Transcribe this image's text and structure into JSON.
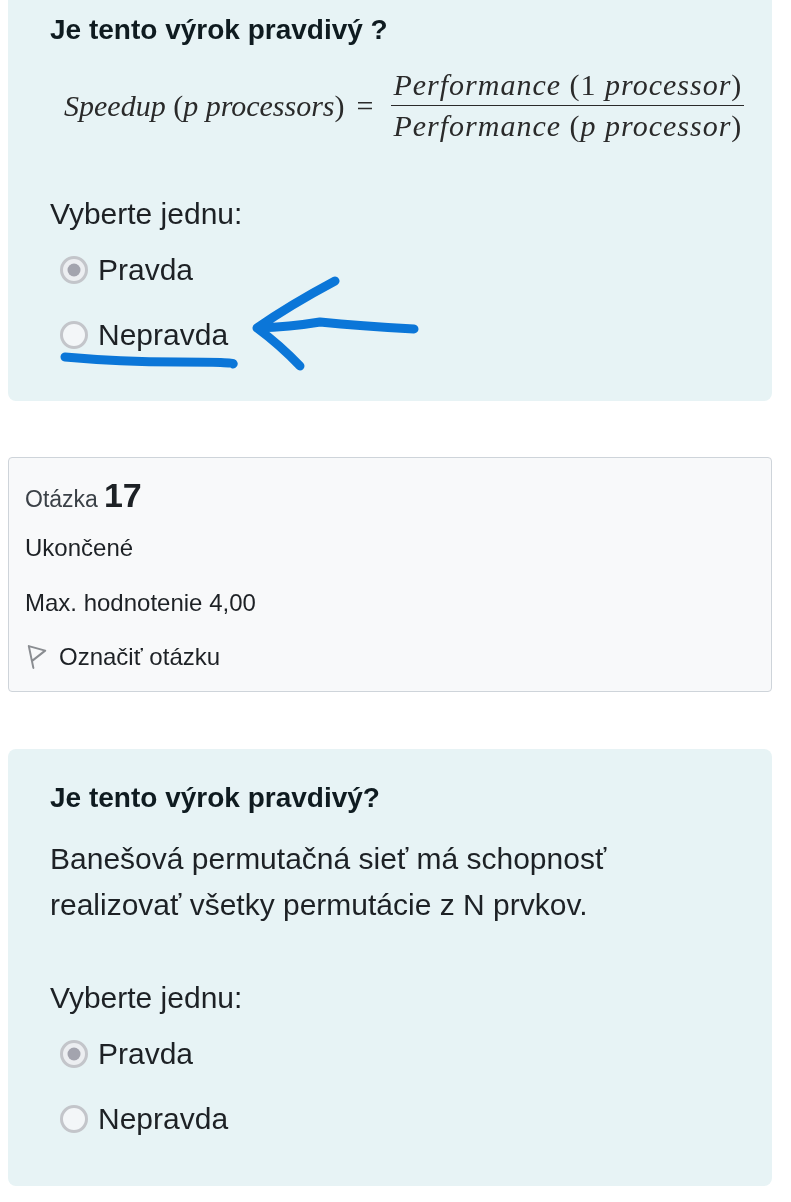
{
  "question_1": {
    "title": "Je tento výrok pravdivý ?",
    "formula": {
      "lhs": "*Speedup* (*p processors*)",
      "operator": "=",
      "numerator": "*Performance* (1 *processor*)",
      "denominator": "*Performance* (*p processor*)"
    },
    "prompt": "Vyberte jednu:",
    "options": [
      {
        "label": "Pravda",
        "selected": true,
        "marked": false
      },
      {
        "label": "Nepravda",
        "selected": false,
        "marked": true
      }
    ]
  },
  "question_info": {
    "label": "Otázka",
    "number": "17",
    "status": "Ukončené",
    "max_grade": "Max. hodnotenie 4,00",
    "flag_link": "Označiť otázku"
  },
  "question_2": {
    "title": "Je tento výrok pravdivý?",
    "text": "Banešová permutačná sieť má schopnosť realizovať všetky permutácie z N prvkov.",
    "prompt": "Vyberte jednu:",
    "options": [
      {
        "label": "Pravda",
        "selected": true
      },
      {
        "label": "Nepravda",
        "selected": false
      }
    ]
  }
}
